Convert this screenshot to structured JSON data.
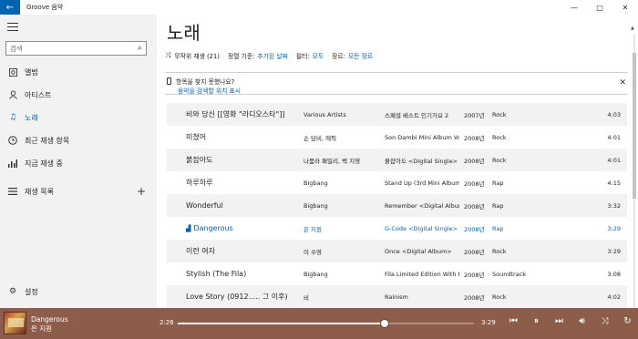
{
  "window": {
    "title": "Groove 음악",
    "minimize": "—",
    "maximize": "□",
    "close": "✕"
  },
  "sidebar": {
    "search_placeholder": "검색",
    "items": [
      {
        "label": "앨범",
        "icon": "album-icon"
      },
      {
        "label": "아티스트",
        "icon": "artist-icon"
      },
      {
        "label": "노래",
        "icon": "music-note-icon",
        "active": true
      },
      {
        "label": "최근 재생 항목",
        "icon": "clock-icon"
      },
      {
        "label": "지금 재생 중",
        "icon": "now-playing-icon"
      },
      {
        "label": "재생 목록",
        "icon": "playlist-icon"
      }
    ],
    "settings": "설정"
  },
  "main": {
    "title": "노래",
    "filterbar": {
      "shuffle": "무작위 재생 (21)",
      "sort_label": "정렬 기준:",
      "sort_value": "추가된 날짜",
      "filter_label": "필터:",
      "filter_value": "모두",
      "genre_label": "장르:",
      "genre_value": "모든 장르"
    },
    "notice": {
      "question": "항목을 찾지 못했나요?",
      "link": "음악을 검색할 위치 표시"
    },
    "songs": [
      {
        "title": "비와 당신 [[영화 \"라디오스타\"]]",
        "artist": "Various Artists",
        "album": "스페셜 베스트 인기가요 2",
        "year": "2007년",
        "genre": "Rock",
        "duration": "4:03"
      },
      {
        "title": "미쳤어",
        "artist": "손 담비, 에픽",
        "album": "Son Dambi Mini Album Vol",
        "year": "2008년",
        "genre": "Rock",
        "duration": "4:01"
      },
      {
        "title": "붉잡아도",
        "artist": "나뭄라 패밀리, 백 지영",
        "album": "붉잡아도 <Digital Single>",
        "year": "2008년",
        "genre": "Rock",
        "duration": "4:01"
      },
      {
        "title": "하루하루",
        "artist": "Bigbang",
        "album": "Stand Up (3rd Mini Album",
        "year": "2008년",
        "genre": "Rap",
        "duration": "4:15"
      },
      {
        "title": "Wonderful",
        "artist": "Bigbang",
        "album": "Remember <Digital Album",
        "year": "2008년",
        "genre": "Rap",
        "duration": "3:32"
      },
      {
        "title": "Dangerous",
        "artist": "은 지원",
        "album": "G-Code <Digital Single>",
        "year": "2008년",
        "genre": "Rap",
        "duration": "3:29",
        "playing": true
      },
      {
        "title": "이런 여자",
        "artist": "이 수영",
        "album": "Once <Digital Album>",
        "year": "2008년",
        "genre": "Rock",
        "duration": "3:29"
      },
      {
        "title": "Stylish (The Fila)",
        "artist": "Bigbang",
        "album": "Fila Limited Edition With B",
        "year": "2008년",
        "genre": "Soundtrack",
        "duration": "3:08"
      },
      {
        "title": "Love Story (0912..... 그 이후)",
        "artist": "비",
        "album": "Rainism",
        "year": "2008년",
        "genre": "Rock",
        "duration": "4:02"
      }
    ]
  },
  "player": {
    "title": "Dangerous",
    "artist": "은 지원",
    "current_time": "2:26",
    "total_time": "3:29",
    "progress": 0.699
  }
}
